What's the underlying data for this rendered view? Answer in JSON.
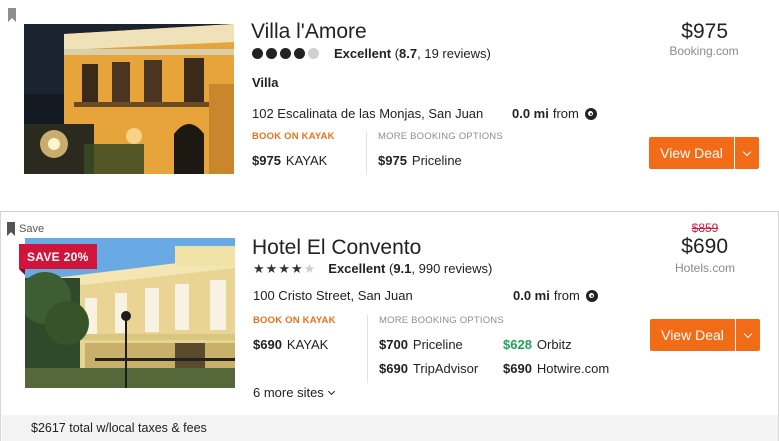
{
  "hotels": [
    {
      "name": "Villa l'Amore",
      "stars": 4,
      "rating_word": "Excellent",
      "score": "8.7",
      "reviews": ", 19 reviews)",
      "type": "Villa",
      "address": "102 Escalinata de las Monjas, San Juan",
      "distance": "0.0 mi",
      "distance_suffix": "from",
      "kayak_label": "BOOK ON KAYAK",
      "more_label": "MORE BOOKING OPTIONS",
      "kayak_offer": {
        "price": "$975",
        "site": "KAYAK"
      },
      "offers": [
        {
          "price": "$975",
          "site": "Priceline"
        }
      ],
      "price": "$975",
      "price_source": "Booking.com",
      "deal_label": "View Deal"
    },
    {
      "save_label": "Save",
      "discount": "SAVE 20%",
      "name": "Hotel El Convento",
      "stars": 4,
      "rating_word": "Excellent",
      "score": "9.1",
      "reviews": ", 990 reviews)",
      "address": "100 Cristo Street, San Juan",
      "distance": "0.0 mi",
      "distance_suffix": "from",
      "kayak_label": "BOOK ON KAYAK",
      "more_label": "MORE BOOKING OPTIONS",
      "kayak_offer": {
        "price": "$690",
        "site": "KAYAK"
      },
      "offers": [
        {
          "price": "$700",
          "site": "Priceline"
        },
        {
          "price": "$628",
          "site": "Orbitz",
          "highlight_color": "#1fa35a"
        },
        {
          "price": "$690",
          "site": "TripAdvisor"
        },
        {
          "price": "$690",
          "site": "Hotwire.com"
        }
      ],
      "old_price": "$859",
      "price": "$690",
      "price_source": "Hotels.com",
      "deal_label": "View Deal",
      "more_sites": "6 more sites",
      "total_text": "$2617 total w/local taxes & fees"
    }
  ],
  "icons": {
    "bookmark": "bookmark-icon",
    "map_pin": "map-pin-icon",
    "chevron": "chevron-down-icon"
  },
  "colors": {
    "accent": "#f26b16",
    "kayak_label": "#e8711c",
    "discount": "#d1143c",
    "deal_green": "#1fa35a",
    "strike": "#c2203e"
  }
}
